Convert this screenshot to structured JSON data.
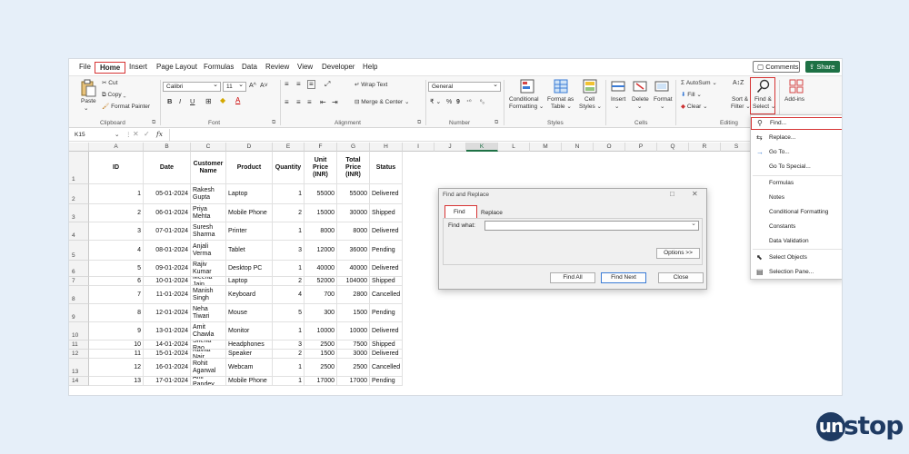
{
  "menu": {
    "tabs": [
      "File",
      "Home",
      "Insert",
      "Page Layout",
      "Formulas",
      "Data",
      "Review",
      "View",
      "Developer",
      "Help"
    ],
    "active_tab": "Home",
    "comments_label": "Comments",
    "share_label": "Share"
  },
  "ribbon": {
    "clipboard": {
      "paste": "Paste",
      "cut": "Cut",
      "copy": "Copy",
      "format_painter": "Format Painter",
      "label": "Clipboard"
    },
    "font": {
      "name": "Calibri",
      "size": "11",
      "label": "Font",
      "bold": "B",
      "italic": "I",
      "underline": "U"
    },
    "alignment": {
      "wrap_text": "Wrap Text",
      "merge_center": "Merge & Center",
      "label": "Alignment"
    },
    "number": {
      "format": "General",
      "label": "Number",
      "pct": "%",
      "comma": "9"
    },
    "styles": {
      "conditional": "Conditional",
      "conditional2": "Formatting",
      "format_as": "Format as",
      "format_as2": "Table",
      "cell": "Cell",
      "cell2": "Styles",
      "label": "Styles"
    },
    "cells": {
      "insert": "Insert",
      "delete": "Delete",
      "format": "Format",
      "label": "Cells"
    },
    "editing": {
      "autosum": "AutoSum",
      "fill": "Fill",
      "clear": "Clear",
      "sort": "Sort &",
      "sort2": "Filter",
      "find": "Find &",
      "find2": "Select",
      "label": "Editing"
    },
    "addins": {
      "label": "Add-ins"
    }
  },
  "formula_bar": {
    "name_box": "K15",
    "fx": "fx"
  },
  "columns": [
    "A",
    "B",
    "C",
    "D",
    "E",
    "F",
    "G",
    "H",
    "I",
    "J",
    "K",
    "L",
    "M",
    "N",
    "O",
    "P",
    "Q",
    "R",
    "S",
    "T",
    "U"
  ],
  "selected_column": "K",
  "headers": {
    "id": "ID",
    "date": "Date",
    "customer": "Customer Name",
    "product": "Product",
    "quantity": "Quantity",
    "unit_price": "Unit Price (INR)",
    "total_price": "Total Price (INR)",
    "status": "Status"
  },
  "rows": [
    {
      "n": "2",
      "id": "1",
      "date": "05-01-2024",
      "customer": "Rakesh Gupta",
      "product": "Laptop",
      "qty": "1",
      "unit": "55000",
      "total": "55000",
      "status": "Delivered"
    },
    {
      "n": "3",
      "id": "2",
      "date": "06-01-2024",
      "customer": "Priya Mehta",
      "product": "Mobile Phone",
      "qty": "2",
      "unit": "15000",
      "total": "30000",
      "status": "Shipped"
    },
    {
      "n": "4",
      "id": "3",
      "date": "07-01-2024",
      "customer": "Suresh Sharma",
      "product": "Printer",
      "qty": "1",
      "unit": "8000",
      "total": "8000",
      "status": "Delivered"
    },
    {
      "n": "5",
      "id": "4",
      "date": "08-01-2024",
      "customer": "Anjali Verma",
      "product": "Tablet",
      "qty": "3",
      "unit": "12000",
      "total": "36000",
      "status": "Pending"
    },
    {
      "n": "6",
      "id": "5",
      "date": "09-01-2024",
      "customer": "Rajiv Kumar",
      "product": "Desktop PC",
      "qty": "1",
      "unit": "40000",
      "total": "40000",
      "status": "Delivered"
    },
    {
      "n": "7",
      "id": "6",
      "date": "10-01-2024",
      "customer": "Meena Jain",
      "product": "Laptop",
      "qty": "2",
      "unit": "52000",
      "total": "104000",
      "status": "Shipped"
    },
    {
      "n": "8",
      "id": "7",
      "date": "11-01-2024",
      "customer": "Manish Singh",
      "product": "Keyboard",
      "qty": "4",
      "unit": "700",
      "total": "2800",
      "status": "Cancelled"
    },
    {
      "n": "9",
      "id": "8",
      "date": "12-01-2024",
      "customer": "Neha Tiwari",
      "product": "Mouse",
      "qty": "5",
      "unit": "300",
      "total": "1500",
      "status": "Pending"
    },
    {
      "n": "10",
      "id": "9",
      "date": "13-01-2024",
      "customer": "Amit Chawla",
      "product": "Monitor",
      "qty": "1",
      "unit": "10000",
      "total": "10000",
      "status": "Delivered"
    },
    {
      "n": "11",
      "id": "10",
      "date": "14-01-2024",
      "customer": "Sneha Rao",
      "product": "Headphones",
      "qty": "3",
      "unit": "2500",
      "total": "7500",
      "status": "Shipped"
    },
    {
      "n": "12",
      "id": "11",
      "date": "15-01-2024",
      "customer": "Kavita Nair",
      "product": "Speaker",
      "qty": "2",
      "unit": "1500",
      "total": "3000",
      "status": "Delivered"
    },
    {
      "n": "13",
      "id": "12",
      "date": "16-01-2024",
      "customer": "Rohit Agarwal",
      "product": "Webcam",
      "qty": "1",
      "unit": "2500",
      "total": "2500",
      "status": "Cancelled"
    },
    {
      "n": "14",
      "id": "13",
      "date": "17-01-2024",
      "customer": "Anil Pandey",
      "product": "Mobile Phone",
      "qty": "1",
      "unit": "17000",
      "total": "17000",
      "status": "Pending"
    }
  ],
  "dialog": {
    "title": "Find and Replace",
    "tab_find": "Find",
    "tab_replace": "Replace",
    "find_what_label": "Find what:",
    "find_what_value": "",
    "options": "Options >>",
    "find_all": "Find All",
    "find_next": "Find Next",
    "close": "Close"
  },
  "dropdown": {
    "items": [
      "Find...",
      "Replace...",
      "Go To...",
      "Go To Special...",
      "Formulas",
      "Notes",
      "Conditional Formatting",
      "Constants",
      "Data Validation",
      "Select Objects",
      "Selection Pane..."
    ]
  },
  "logo": {
    "u": "un",
    "rest": "stop"
  },
  "colors": {
    "excel_green": "#1e7145",
    "highlight_red": "#d63333",
    "background": "#e6eff9",
    "logo_navy": "#1f3b63"
  }
}
